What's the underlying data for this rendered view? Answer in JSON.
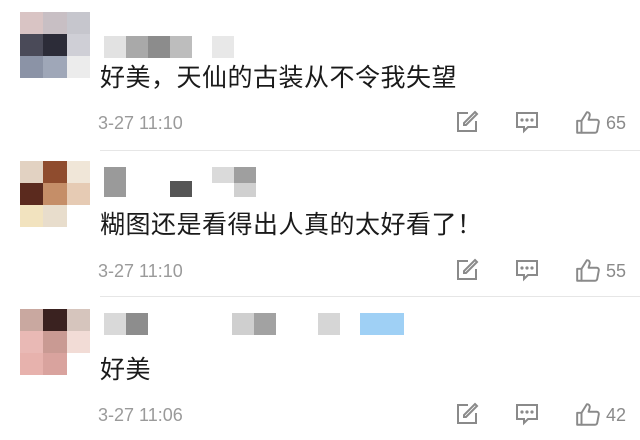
{
  "comments": [
    {
      "text": "好美，天仙的古装从不令我失望",
      "time": "3-27 11:10",
      "likes": "65",
      "avatar_colors": [
        "#d9c4c4",
        "#c8bfc4",
        "#c6c6cd",
        "#4a4a58",
        "#2c2c38",
        "#cfcfd6",
        "#8b93a6",
        "#9fa7b8",
        "#ececec"
      ],
      "name_blocks": [
        "#e2e2e2",
        "#a9a9a9",
        "#8c8c8c",
        "#bdbdbd",
        "#e8e8e8"
      ]
    },
    {
      "text": "糊图还是看得出人真的太好看了！",
      "time": "3-27 11:10",
      "likes": "55",
      "avatar_colors": [
        "#e2d2c2",
        "#8f4c2e",
        "#f0e6d8",
        "#5b2a1e",
        "#c58e68",
        "#e6cbb4",
        "#f2e3bf",
        "#e8ddcc",
        "#ffffff"
      ],
      "name_blocks": [
        "#9a9a9a",
        "#555555",
        "#dadada",
        "#9f9f9f",
        "#d0d0d0"
      ]
    },
    {
      "text": "好美",
      "time": "3-27 11:06",
      "likes": "42",
      "avatar_colors": [
        "#c9a8a0",
        "#3a2220",
        "#d6c5bd",
        "#e9b9b5",
        "#c99a93",
        "#f2dcd6",
        "#e7b2ad",
        "#d9a39e",
        "#ffffff"
      ],
      "name_blocks": [
        "#d9d9d9",
        "#8d8d8d",
        "#cfcfcf",
        "#a2a2a2",
        "#d6d6d6",
        "#9fd0f5"
      ]
    }
  ]
}
